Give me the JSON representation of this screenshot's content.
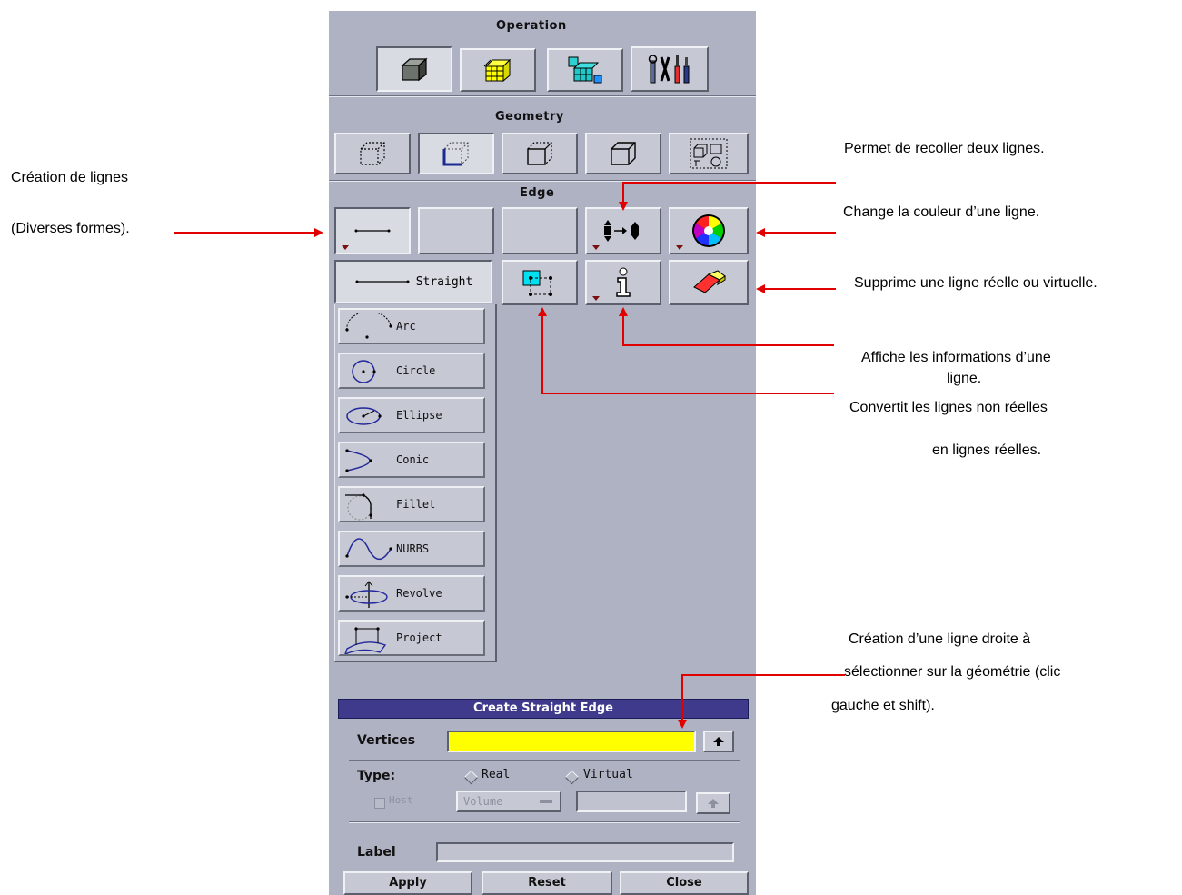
{
  "panel": {
    "operation": {
      "title": "Operation",
      "buttons": [
        {
          "icon": "cube-solid-icon"
        },
        {
          "icon": "mesh-cube-icon"
        },
        {
          "icon": "zones-mesh-icon"
        },
        {
          "icon": "tools-icon"
        }
      ]
    },
    "geometry": {
      "title": "Geometry",
      "buttons": [
        {
          "icon": "vertex-icon"
        },
        {
          "icon": "edge-icon"
        },
        {
          "icon": "face-icon"
        },
        {
          "icon": "volume-icon"
        },
        {
          "icon": "group-icon"
        }
      ]
    },
    "edge": {
      "title": "Edge",
      "buttons_row1": [
        {
          "icon": "straight-line-icon"
        },
        {
          "icon": "blank"
        },
        {
          "icon": "blank"
        },
        {
          "icon": "connect-edges-icon"
        },
        {
          "icon": "color-wheel-icon"
        }
      ],
      "buttons_row2": [
        {
          "icon": "convert-virtual-icon"
        },
        {
          "icon": "info-icon"
        },
        {
          "icon": "eraser-icon"
        }
      ]
    },
    "flyout": {
      "selected": "Straight",
      "items": [
        "Arc",
        "Circle",
        "Ellipse",
        "Conic",
        "Fillet",
        "NURBS",
        "Revolve",
        "Project"
      ]
    }
  },
  "form": {
    "title": "Create Straight Edge",
    "vertices_label": "Vertices",
    "vertices_value": "",
    "type_label": "Type:",
    "type_options": [
      "Real",
      "Virtual"
    ],
    "host_label": "Host",
    "host_select": "Volume",
    "label_label": "Label",
    "buttons": [
      "Apply",
      "Reset",
      "Close"
    ]
  },
  "annotations": {
    "creation_lignes_1": "Création de lignes",
    "creation_lignes_2": "(Diverses formes).",
    "recoller": "Permet de recoller deux lignes.",
    "couleur": "Change  la couleur d’une ligne.",
    "supprime": "Supprime une ligne réelle ou virtuelle.",
    "info_1": "Affiche les informations d’une",
    "info_2": "ligne.",
    "convertit_1": "Convertit les lignes non réelles",
    "convertit_2": "en lignes réelles.",
    "droite_1": "Création d’une ligne droite à",
    "droite_2": "sélectionner sur la géométrie (clic",
    "droite_3": "gauche et shift)."
  },
  "colors": {
    "arrow": "#e00000",
    "form_title_bg": "#3f3a8c",
    "vertices_field": "#ffff00",
    "panel_bg": "#aeb2c3"
  }
}
